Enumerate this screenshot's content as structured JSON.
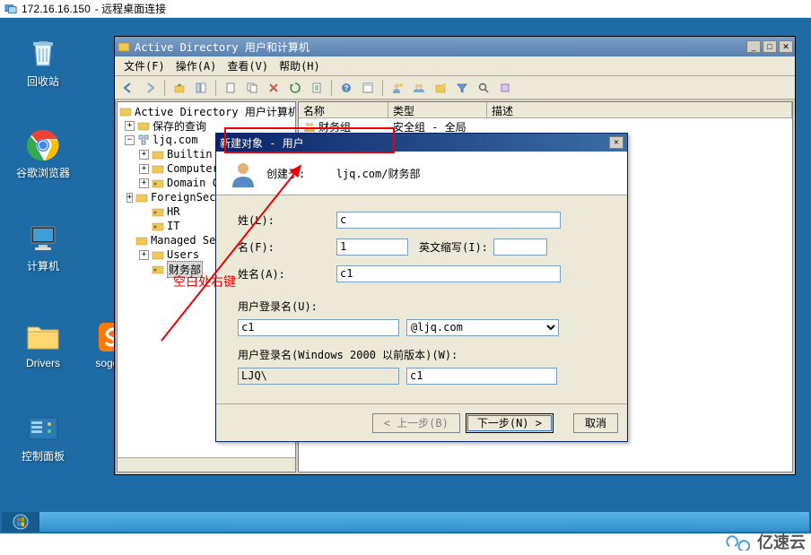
{
  "rdp": {
    "address": "172.16.16.150",
    "suffix": " - 远程桌面连接"
  },
  "desktop": {
    "icons": {
      "recycle": "回收站",
      "chrome": "谷歌浏览器",
      "computer": "计算机",
      "drivers": "Drivers",
      "sogou": "sogou_",
      "ctrl_panel": "控制面板"
    }
  },
  "mmc": {
    "title": "Active Directory 用户和计算机",
    "menu": {
      "file": "文件(F)",
      "action": "操作(A)",
      "view": "查看(V)",
      "help": "帮助(H)"
    },
    "tree": {
      "root": "Active Directory 用户计算机",
      "saved_queries": "保存的查询",
      "domain": "ljq.com",
      "builtin": "Builtin",
      "computers": "Computers",
      "dc": "Domain Controllers",
      "fsp": "ForeignSecurityPrincip",
      "hr": "HR",
      "it": "IT",
      "msa": "Managed Service Accoun",
      "users": "Users",
      "finance": "财务部"
    },
    "list": {
      "cols": {
        "name": "名称",
        "type": "类型",
        "desc": "描述"
      },
      "rows": [
        {
          "name": "财务组",
          "type": "安全组 - 全局",
          "desc": ""
        }
      ]
    }
  },
  "wizard": {
    "title": "新建对象 - 用户",
    "created_in_label": "创建于:",
    "created_in_value": "ljq.com/财务部",
    "labels": {
      "surname": "姓(L):",
      "given": "名(F):",
      "initials": "英文缩写(I):",
      "display": "姓名(A):",
      "upn": "用户登录名(U):",
      "sam_label": "用户登录名(Windows 2000 以前版本)(W):"
    },
    "values": {
      "surname": "c",
      "given": "1",
      "initials": "",
      "display": "c1",
      "upn_prefix": "c1",
      "upn_suffix": "@ljq.com",
      "sam_domain": "LJQ\\",
      "sam_name": "c1"
    },
    "buttons": {
      "back": "< 上一步(B)",
      "next": "下一步(N) >",
      "cancel": "取消"
    }
  },
  "annotations": {
    "hint": "空白处右键"
  },
  "watermark": "亿速云"
}
